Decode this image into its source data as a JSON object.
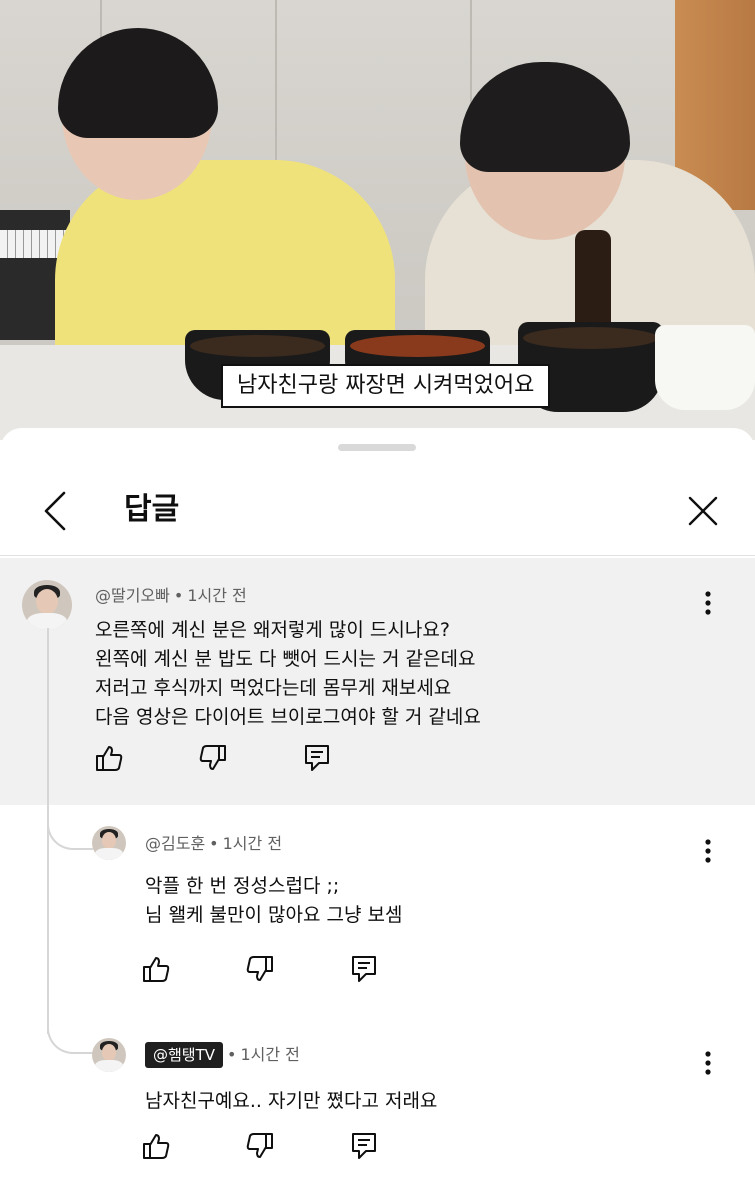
{
  "video": {
    "caption": "남자친구랑 짜장면 시켜먹었어요"
  },
  "panel": {
    "title": "답글"
  },
  "comments": [
    {
      "author": "@딸기오빠",
      "time": "1시간 전",
      "lines": [
        "오른쪽에 계신 분은 왜저렇게 많이 드시나요?",
        "왼쪽에 계신 분 밥도 다 뺏어 드시는 거 같은데요",
        "저러고 후식까지 먹었다는데 몸무게 재보세요",
        "다음 영상은 다이어트 브이로그여야 할 거 같네요"
      ]
    },
    {
      "author": "@김도훈",
      "time": "1시간 전",
      "lines": [
        "악플 한 번 정성스럽다 ;;",
        "님 왤케 불만이 많아요 그냥 보셈"
      ]
    },
    {
      "author": "@햄탱TV",
      "time": "1시간 전",
      "lines": [
        "남자친구예요.. 자기만 쪘다고 저래요"
      ]
    }
  ],
  "separator": "•",
  "icons": {
    "back": "chevron-left-icon",
    "close": "close-icon",
    "more": "more-vert-icon",
    "like": "thumb-up-icon",
    "dislike": "thumb-down-icon",
    "reply": "reply-icon"
  },
  "colors": {
    "highlight_bg": "#f1f1f1",
    "author_badge_bg": "#1f1f1f",
    "meta_text": "#606060"
  }
}
